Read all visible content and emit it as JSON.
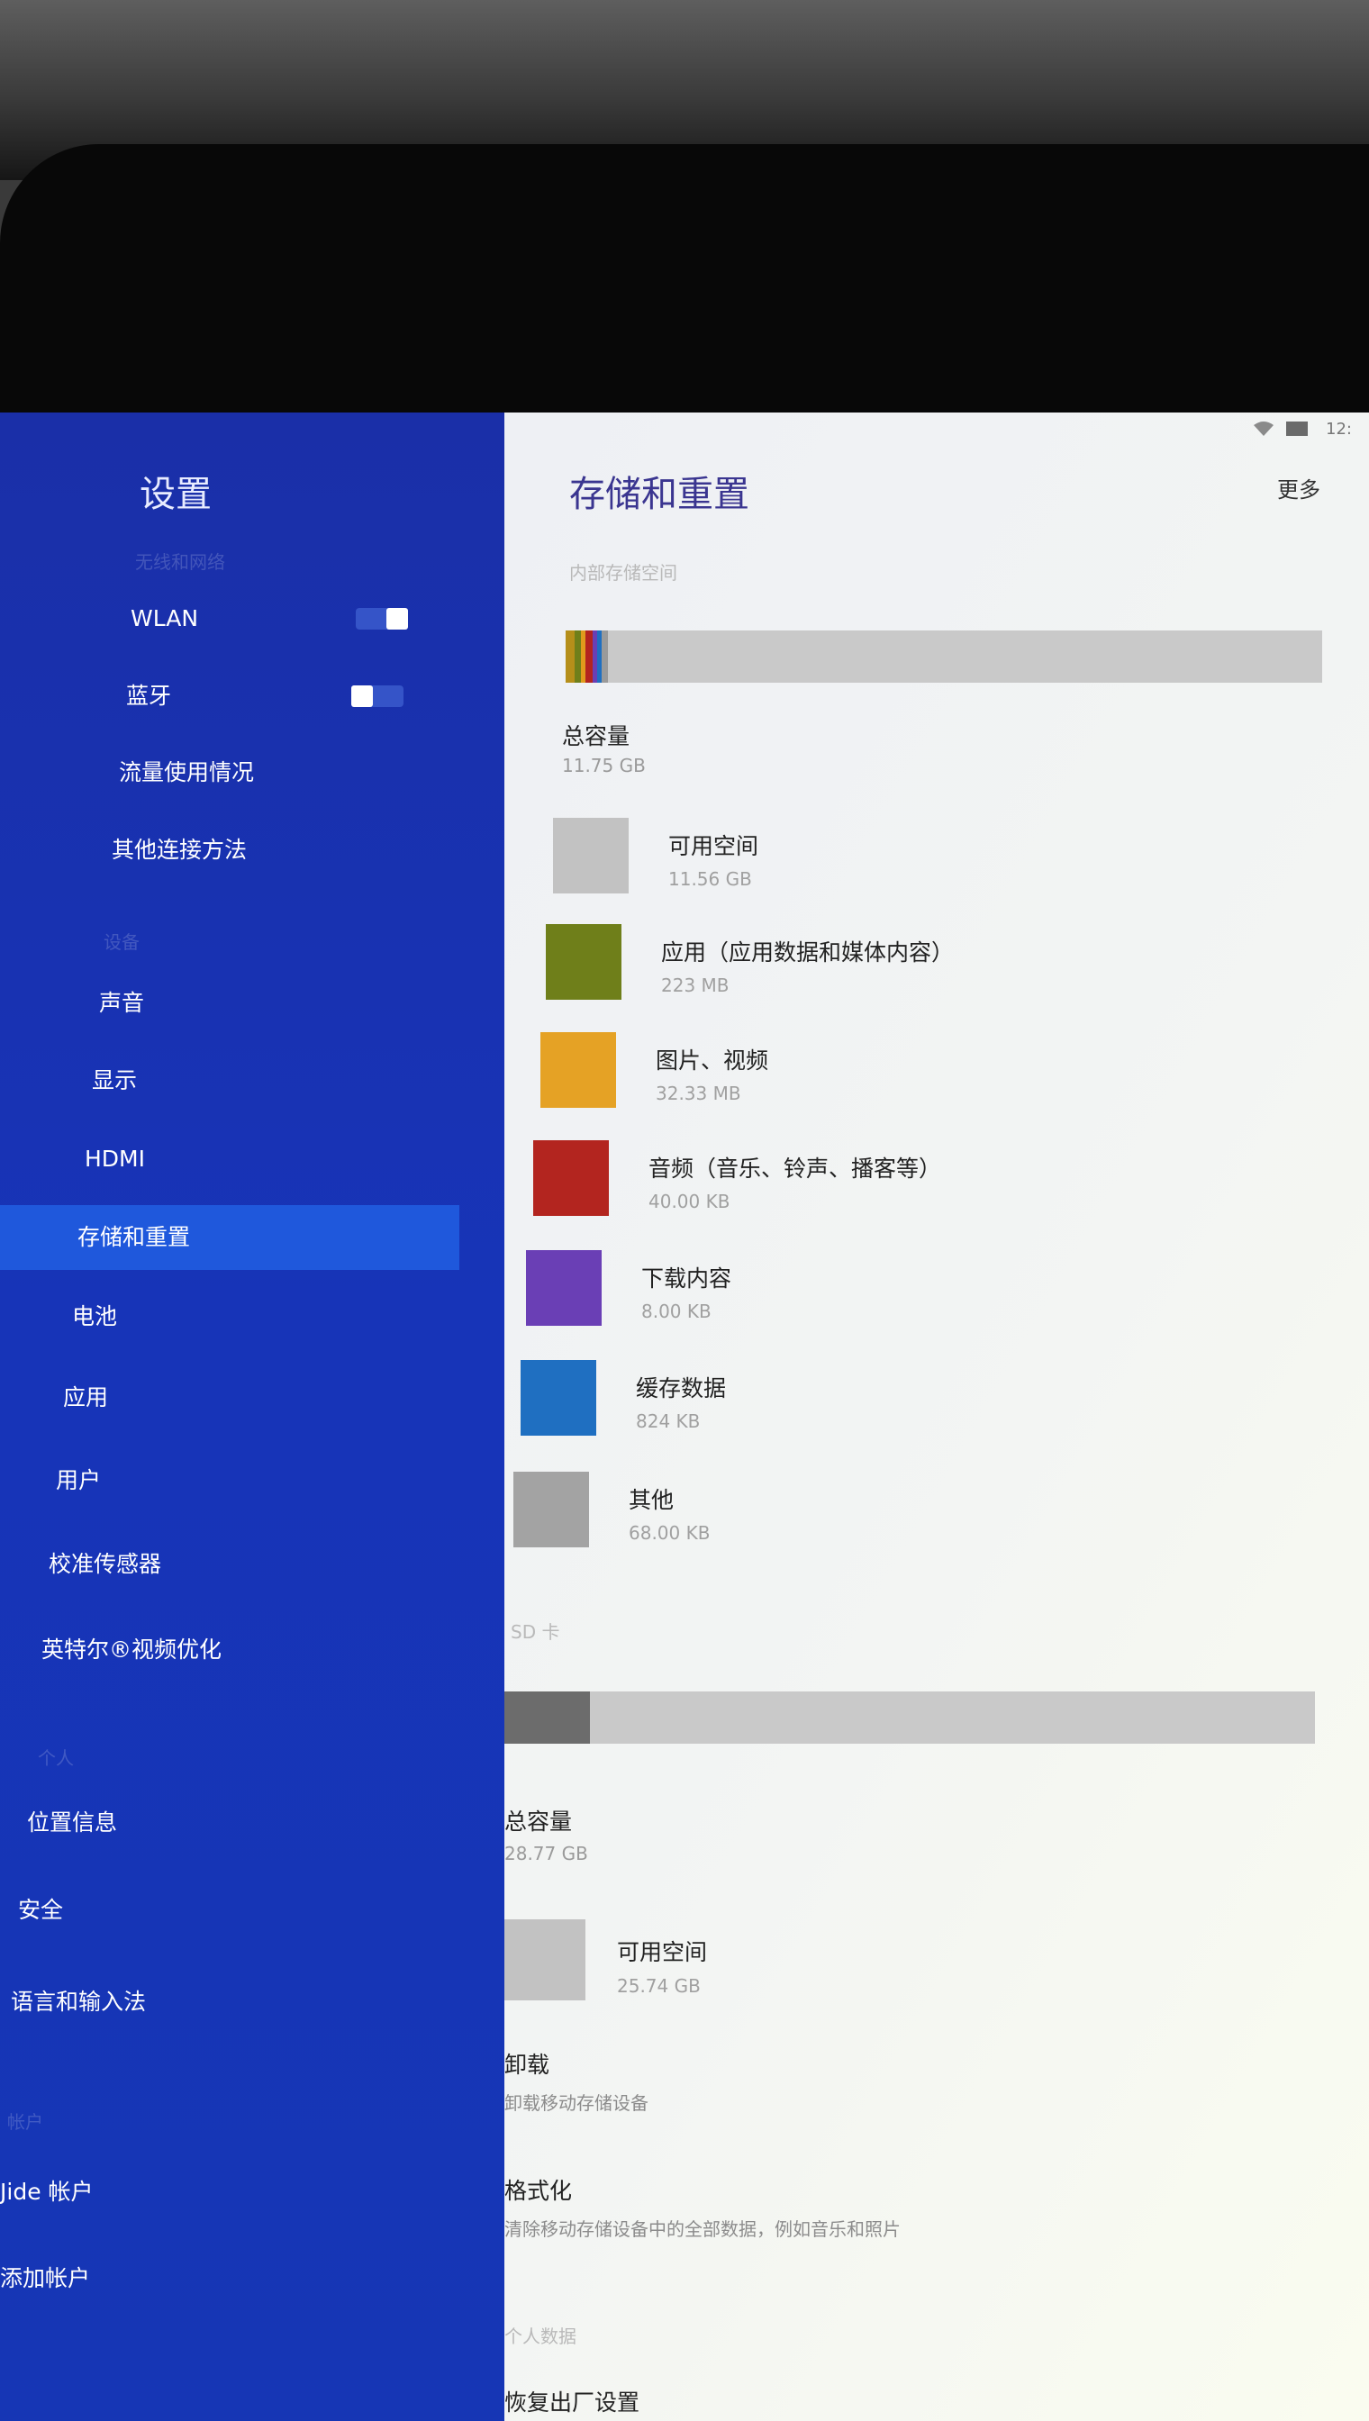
{
  "sidebar": {
    "title": "设置",
    "sections": [
      "无线和网络",
      "设备",
      "个人",
      "帐户"
    ],
    "items": [
      {
        "label": "WLAN"
      },
      {
        "label": "蓝牙"
      },
      {
        "label": "流量使用情况"
      },
      {
        "label": "其他连接方法"
      },
      {
        "label": "声音"
      },
      {
        "label": "显示"
      },
      {
        "label": "HDMI"
      },
      {
        "label": "存储和重置"
      },
      {
        "label": "电池"
      },
      {
        "label": "应用"
      },
      {
        "label": "用户"
      },
      {
        "label": "校准传感器"
      },
      {
        "label": "英特尔®视频优化"
      },
      {
        "label": "位置信息"
      },
      {
        "label": "安全"
      },
      {
        "label": "语言和输入法"
      },
      {
        "label": "Jide 帐户"
      },
      {
        "label": "添加帐户"
      }
    ],
    "toggles": {
      "wlan_on": true,
      "bluetooth_on": false
    }
  },
  "status_bar": {
    "time": "12:"
  },
  "main": {
    "title": "存储和重置",
    "more_label": "更多",
    "internal": {
      "section_label": "内部存储空间",
      "total_label": "总容量",
      "total_value": "11.75 GB",
      "usage_colors": [
        "#b58f1a",
        "#6f7f1a",
        "#e09b1c",
        "#b3251f",
        "#6a3fb5",
        "#1f6fc1",
        "#9a9a9a"
      ],
      "usage_fractions": [
        0.012,
        0.008,
        0.006,
        0.01,
        0.006,
        0.006,
        0.008
      ],
      "legend": [
        {
          "label": "可用空间",
          "value": "11.56 GB",
          "color": "#c2c2c2"
        },
        {
          "label": "应用（应用数据和媒体内容）",
          "value": "223 MB",
          "color": "#6f7f1a"
        },
        {
          "label": "图片、视频",
          "value": "32.33 MB",
          "color": "#e5a225"
        },
        {
          "label": "音频（音乐、铃声、播客等）",
          "value": "40.00 KB",
          "color": "#b3251f"
        },
        {
          "label": "下载内容",
          "value": "8.00 KB",
          "color": "#6a3fb5"
        },
        {
          "label": "缓存数据",
          "value": "824 KB",
          "color": "#1f6fc1"
        },
        {
          "label": "其他",
          "value": "68.00 KB",
          "color": "#a3a3a3"
        }
      ]
    },
    "sd": {
      "section_label": "SD 卡",
      "total_label": "总容量",
      "total_value": "28.77 GB",
      "used_fraction": 0.105,
      "used_color": "#6c6c6c",
      "free_label": "可用空间",
      "free_value": "25.74 GB",
      "free_color": "#c2c2c2"
    },
    "unmount": {
      "title": "卸载",
      "subtitle": "卸载移动存储设备"
    },
    "format": {
      "title": "格式化",
      "subtitle": "清除移动存储设备中的全部数据，例如音乐和照片"
    },
    "personal_section_label": "个人数据",
    "factory_reset_title": "恢复出厂设置"
  }
}
